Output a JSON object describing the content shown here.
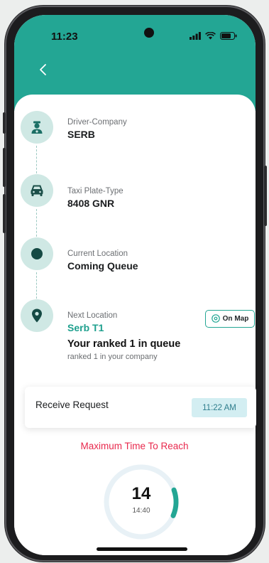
{
  "status_bar": {
    "time": "11:23"
  },
  "header": {
    "back_icon": "chevron-left-icon",
    "color": "#23a694"
  },
  "steps": [
    {
      "icon": "driver-icon",
      "label": "Driver-Company",
      "value": "SERB"
    },
    {
      "icon": "taxi-icon",
      "label": "Taxi Plate-Type",
      "value": "8408 GNR"
    },
    {
      "icon": "dot-icon",
      "label": "Current Location",
      "value": "Coming Queue"
    },
    {
      "icon": "location-pin-icon",
      "label": "Next Location",
      "value": "Serb T1"
    }
  ],
  "on_map": {
    "label": "On Map",
    "icon": "location-pin-icon"
  },
  "queue": {
    "rank_text": "Your ranked 1 in queue",
    "rank_sub": "ranked 1 in your company"
  },
  "request": {
    "label": "Receive Request",
    "time": "11:22 AM"
  },
  "max_time": {
    "label": "Maximum Time To Reach",
    "color": "#e8294d"
  },
  "timer": {
    "value": "14",
    "sub": "14:40",
    "progress": 0.12
  }
}
